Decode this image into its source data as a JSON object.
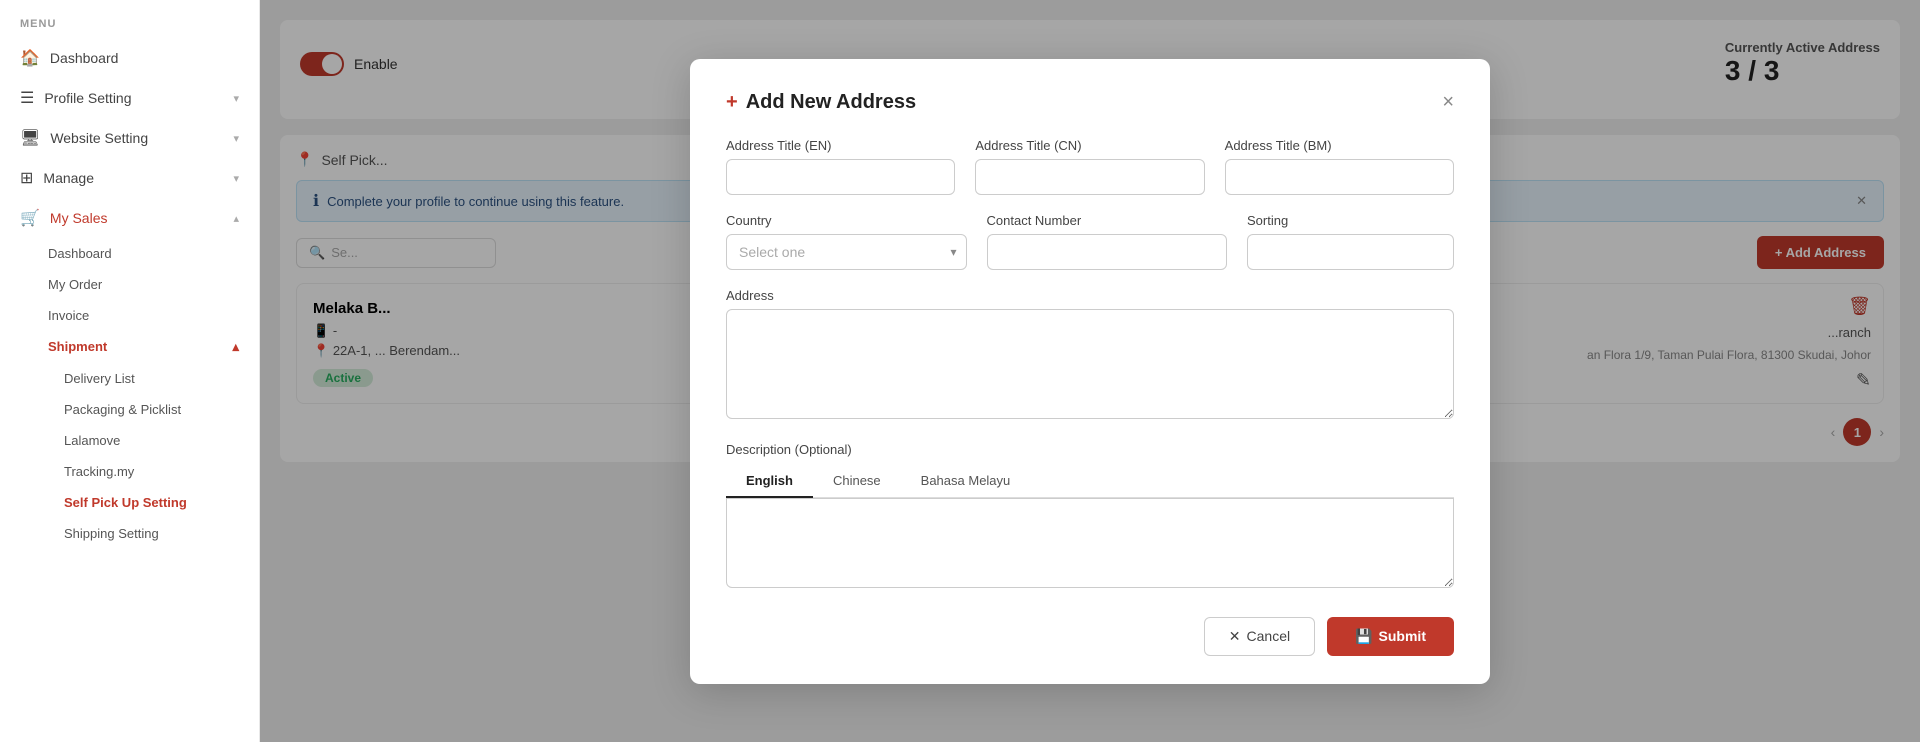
{
  "sidebar": {
    "menu_label": "MENU",
    "items": [
      {
        "id": "dashboard",
        "label": "Dashboard",
        "icon": "🏠",
        "expandable": false
      },
      {
        "id": "profile-setting",
        "label": "Profile Setting",
        "icon": "☰",
        "expandable": true
      },
      {
        "id": "website-setting",
        "label": "Website Setting",
        "icon": "🖥",
        "expandable": true
      },
      {
        "id": "manage",
        "label": "Manage",
        "icon": "⊞",
        "expandable": true
      },
      {
        "id": "my-sales",
        "label": "My Sales",
        "icon": "🛒",
        "expandable": true,
        "active": true
      }
    ],
    "sub_items_my_sales": [
      {
        "id": "dashboard-sub",
        "label": "Dashboard"
      },
      {
        "id": "my-order",
        "label": "My Order"
      },
      {
        "id": "invoice",
        "label": "Invoice"
      },
      {
        "id": "shipment",
        "label": "Shipment",
        "active": true,
        "expandable": true
      },
      {
        "id": "delivery-list",
        "label": "Delivery List"
      },
      {
        "id": "packaging-picklist",
        "label": "Packaging & Picklist"
      },
      {
        "id": "lalamove",
        "label": "Lalamove"
      },
      {
        "id": "tracking-my",
        "label": "Tracking.my"
      },
      {
        "id": "self-pick-up-setting",
        "label": "Self Pick Up Setting",
        "active": true
      },
      {
        "id": "shipping-setting",
        "label": "Shipping Setting"
      }
    ]
  },
  "main": {
    "currently_active_label": "Currently Active Address",
    "page_count": "3 / 3",
    "enable_label": "Enable",
    "info_banner": "Complete your profile to continue using this feature.",
    "search_placeholder": "Se...",
    "add_address_btn": "+ Add Address",
    "self_pick_label": "Self Pick...",
    "address_card": {
      "title": "Melaka B...",
      "phone": "-",
      "address": "22A-1, ...",
      "city": "Berendam...",
      "status": "Active",
      "branch_label": "...ranch",
      "branch_address": "an Flora 1/9, Taman Pulai Flora, 81300 Skudai, Johor"
    },
    "pagination": {
      "current": "1",
      "prev_arrow": "‹",
      "next_arrow": "›"
    }
  },
  "modal": {
    "title": "Add New Address",
    "plus": "+",
    "close": "×",
    "fields": {
      "address_title_en_label": "Address Title (EN)",
      "address_title_en_placeholder": "",
      "address_title_cn_label": "Address Title (CN)",
      "address_title_cn_placeholder": "",
      "address_title_bm_label": "Address Title (BM)",
      "address_title_bm_placeholder": "",
      "country_label": "Country",
      "country_placeholder": "Select one",
      "contact_number_label": "Contact Number",
      "contact_number_placeholder": "",
      "sorting_label": "Sorting",
      "sorting_placeholder": "",
      "address_label": "Address",
      "address_placeholder": "",
      "description_label": "Description (Optional)"
    },
    "lang_tabs": [
      {
        "id": "english",
        "label": "English",
        "active": true
      },
      {
        "id": "chinese",
        "label": "Chinese",
        "active": false
      },
      {
        "id": "bahasa-melayu",
        "label": "Bahasa Melayu",
        "active": false
      }
    ],
    "cancel_btn": "Cancel",
    "submit_btn": "Submit"
  }
}
